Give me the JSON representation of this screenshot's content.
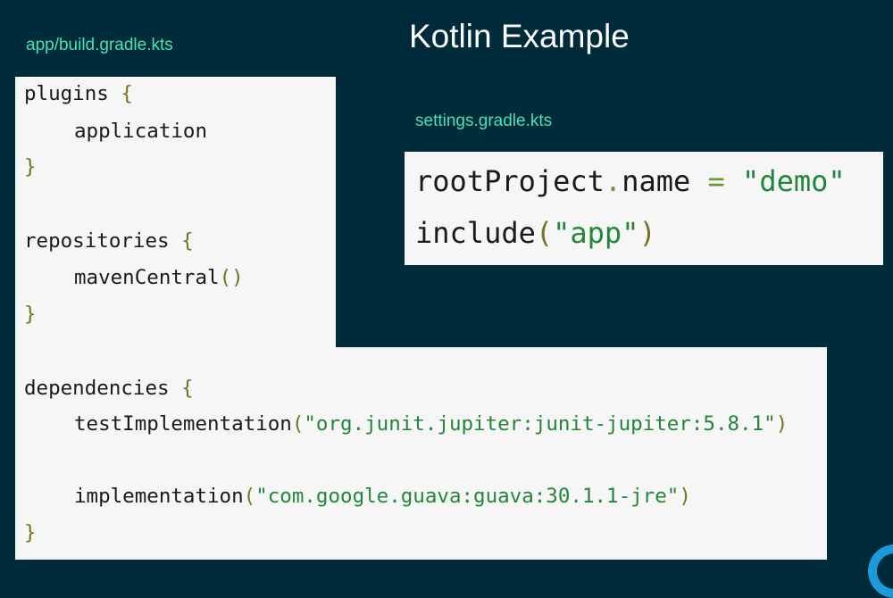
{
  "slide": {
    "title": "Kotlin Example"
  },
  "build_file": {
    "name": "app/build.gradle.kts",
    "lines": {
      "l1_kw": "plugins",
      "l1_brace": "{",
      "l2_text": "application",
      "l3_brace": "}",
      "l5_kw": "repositories",
      "l5_brace": "{",
      "l6_text": "mavenCentral",
      "l6_parens": "()",
      "l7_brace": "}",
      "l9_kw": "dependencies",
      "l9_brace": "{",
      "l10_fn": "testImplementation",
      "l10_open": "(",
      "l10_str": "\"org.junit.jupiter:junit-jupiter:5.8.1\"",
      "l10_close": ")",
      "l12_fn": "implementation",
      "l12_open": "(",
      "l12_str": "\"com.google.guava:guava:30.1.1-jre\"",
      "l12_close": ")",
      "l13_brace": "}"
    }
  },
  "settings_file": {
    "name": "settings.gradle.kts",
    "lines": {
      "s1_obj": "rootProject",
      "s1_dot": ".",
      "s1_prop": "name",
      "s1_eq": "=",
      "s1_str": "\"demo\"",
      "s2_fn": "include",
      "s2_open": "(",
      "s2_str": "\"app\"",
      "s2_close": ")"
    }
  },
  "colors": {
    "background": "#002b3a",
    "file_label": "#46e3b2",
    "title": "#ffffff",
    "code_panel": "#f6f6f6",
    "string": "#22863a",
    "punctuation": "#75741a"
  }
}
